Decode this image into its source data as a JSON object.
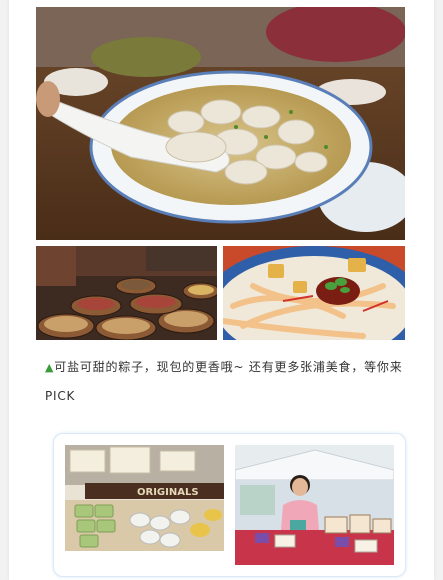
{
  "caption": {
    "marker": "▲",
    "text": "可盐可甜的粽子，现包的更香哦~ 还有更多张浦美食，等你来PICK"
  },
  "images": {
    "main": "wonton-soup-photo",
    "left": "market-grain-stall-photo",
    "right": "spicy-noodles-photo",
    "card_left": "rice-dumpling-display-photo",
    "card_right": "vendor-stall-photo"
  },
  "card_left": {
    "sign_text": "ORIGINALS"
  },
  "colors": {
    "accent_green": "#3a9b3a",
    "card_border": "#d9e9f7"
  }
}
